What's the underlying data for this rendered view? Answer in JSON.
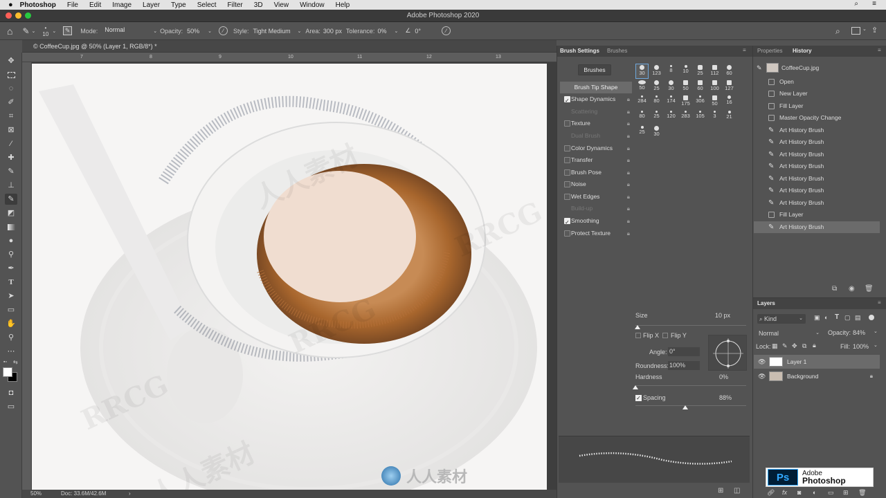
{
  "menubar": {
    "apple": "",
    "app": "Photoshop",
    "items": [
      "File",
      "Edit",
      "Image",
      "Layer",
      "Type",
      "Select",
      "Filter",
      "3D",
      "View",
      "Window",
      "Help"
    ]
  },
  "window": {
    "title": "Adobe Photoshop 2020"
  },
  "options": {
    "size_value": "10",
    "mode_label": "Mode:",
    "mode_value": "Normal",
    "opacity_label": "Opacity:",
    "opacity_value": "50%",
    "style_label": "Style:",
    "style_value": "Tight Medium",
    "area_label": "Area:",
    "area_value": "300 px",
    "tolerance_label": "Tolerance:",
    "tolerance_value": "0%",
    "angle_value": "0°"
  },
  "document": {
    "tab_title": "© CoffeeCup.jpg @ 50% (Layer 1, RGB/8*) *",
    "ruler_numbers": [
      "7",
      "8",
      "9",
      "10",
      "11",
      "12",
      "13"
    ]
  },
  "status": {
    "zoom": "50%",
    "doc": "Doc: 33.6M/42.6M"
  },
  "brush_settings": {
    "tab_active": "Brush Settings",
    "tab_other": "Brushes",
    "brushes_button": "Brushes",
    "tip_shape": "Brush Tip Shape",
    "options": [
      {
        "label": "Shape Dynamics",
        "checked": true,
        "dim": false
      },
      {
        "label": "Scattering",
        "checked": false,
        "dim": true
      },
      {
        "label": "Texture",
        "checked": false,
        "dim": false
      },
      {
        "label": "Dual Brush",
        "checked": false,
        "dim": true
      },
      {
        "label": "Color Dynamics",
        "checked": false,
        "dim": false
      },
      {
        "label": "Transfer",
        "checked": false,
        "dim": false
      },
      {
        "label": "Brush Pose",
        "checked": false,
        "dim": false
      },
      {
        "label": "Noise",
        "checked": false,
        "dim": false
      },
      {
        "label": "Wet Edges",
        "checked": false,
        "dim": false
      },
      {
        "label": "Build-up",
        "checked": false,
        "dim": true
      },
      {
        "label": "Smoothing",
        "checked": true,
        "dim": false
      },
      {
        "label": "Protect Texture",
        "checked": false,
        "dim": false
      }
    ],
    "tip_sizes": [
      "30",
      "123",
      "8",
      "10",
      "25",
      "112",
      "60",
      "50",
      "25",
      "30",
      "50",
      "60",
      "100",
      "127",
      "284",
      "80",
      "174",
      "175",
      "306",
      "50",
      "16",
      "80",
      "25",
      "120",
      "283",
      "105",
      "3",
      "21",
      "25",
      "30"
    ],
    "size_label": "Size",
    "size_value": "10 px",
    "flip_x": "Flip X",
    "flip_y": "Flip Y",
    "angle_label": "Angle:",
    "angle_value": "0°",
    "roundness_label": "Roundness:",
    "roundness_value": "100%",
    "hardness_label": "Hardness",
    "hardness_value": "0%",
    "spacing_label": "Spacing",
    "spacing_value": "88%",
    "spacing_checked": true,
    "size_level": 0.02,
    "hardness_level": 0.0,
    "spacing_level": 0.45
  },
  "history": {
    "tab_other": "Properties",
    "tab_active": "History",
    "snapshot": "CoffeeCup.jpg",
    "items": [
      "Open",
      "New Layer",
      "Fill Layer",
      "Master Opacity Change",
      "Art History Brush",
      "Art History Brush",
      "Art History Brush",
      "Art History Brush",
      "Art History Brush",
      "Art History Brush",
      "Art History Brush",
      "Fill Layer",
      "Art History Brush"
    ],
    "selected_index": 12
  },
  "layers": {
    "title": "Layers",
    "kind": "Kind",
    "blend": "Normal",
    "opacity_label": "Opacity:",
    "opacity_value": "84%",
    "lock_label": "Lock:",
    "fill_label": "Fill:",
    "fill_value": "100%",
    "items": [
      {
        "name": "Layer 1",
        "selected": true
      },
      {
        "name": "Background",
        "selected": false
      }
    ]
  },
  "badge": {
    "ps": "Ps",
    "line1": "Adobe",
    "line2": "Photoshop"
  },
  "watermarks": [
    "RRCG",
    "人人素材",
    "RRCG",
    "人人素材",
    "RRCG",
    "人人素材",
    "人人素材"
  ],
  "colors": {
    "panel": "#535353",
    "menubar": "#e3e3e3",
    "ps_blue": "#31a8ff",
    "coffee": "#a8662d"
  }
}
